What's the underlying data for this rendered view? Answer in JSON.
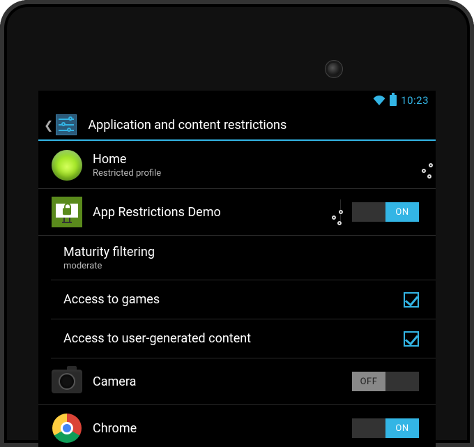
{
  "statusbar": {
    "time": "10:23"
  },
  "actionbar": {
    "title": "Application and content restrictions"
  },
  "rows": {
    "home": {
      "title": "Home",
      "subtitle": "Restricted profile"
    },
    "app_demo": {
      "title": "App Restrictions Demo",
      "toggle": "ON"
    },
    "maturity": {
      "title": "Maturity filtering",
      "subtitle": "moderate"
    },
    "games": {
      "title": "Access to games",
      "checked": true
    },
    "ugc": {
      "title": "Access to user-generated content",
      "checked": true
    },
    "camera": {
      "title": "Camera",
      "toggle": "OFF"
    },
    "chrome": {
      "title": "Chrome",
      "toggle": "ON"
    }
  }
}
